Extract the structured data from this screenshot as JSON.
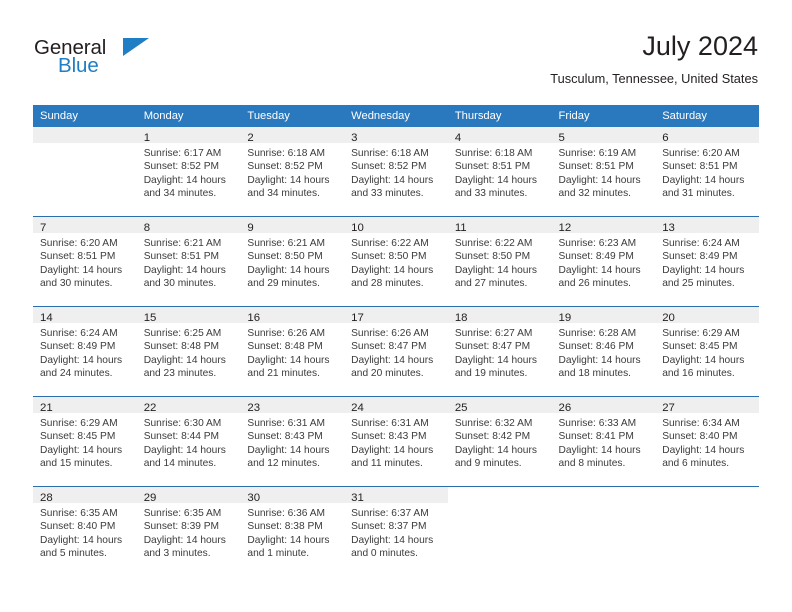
{
  "brand": {
    "word_one": "General",
    "word_two": "Blue",
    "accent_color": "#1f7ec4",
    "triangle_icon": "triangle-icon"
  },
  "header": {
    "title": "July 2024",
    "location": "Tusculum, Tennessee, United States"
  },
  "calendar": {
    "header_bg": "#2a78bd",
    "row_divider_color": "#2a6ead",
    "daynum_band_bg": "#efefef",
    "weekday_headers": [
      "Sunday",
      "Monday",
      "Tuesday",
      "Wednesday",
      "Thursday",
      "Friday",
      "Saturday"
    ],
    "labels": {
      "sunrise": "Sunrise:",
      "sunset": "Sunset:",
      "daylight": "Daylight:"
    },
    "weeks": [
      [
        {
          "day": "",
          "sunrise": "",
          "sunset": "",
          "daylight_line1": "",
          "daylight_line2": "",
          "blank": true
        },
        {
          "day": "1",
          "sunrise": "Sunrise: 6:17 AM",
          "sunset": "Sunset: 8:52 PM",
          "daylight_line1": "Daylight: 14 hours",
          "daylight_line2": "and 34 minutes."
        },
        {
          "day": "2",
          "sunrise": "Sunrise: 6:18 AM",
          "sunset": "Sunset: 8:52 PM",
          "daylight_line1": "Daylight: 14 hours",
          "daylight_line2": "and 34 minutes."
        },
        {
          "day": "3",
          "sunrise": "Sunrise: 6:18 AM",
          "sunset": "Sunset: 8:52 PM",
          "daylight_line1": "Daylight: 14 hours",
          "daylight_line2": "and 33 minutes."
        },
        {
          "day": "4",
          "sunrise": "Sunrise: 6:18 AM",
          "sunset": "Sunset: 8:51 PM",
          "daylight_line1": "Daylight: 14 hours",
          "daylight_line2": "and 33 minutes."
        },
        {
          "day": "5",
          "sunrise": "Sunrise: 6:19 AM",
          "sunset": "Sunset: 8:51 PM",
          "daylight_line1": "Daylight: 14 hours",
          "daylight_line2": "and 32 minutes."
        },
        {
          "day": "6",
          "sunrise": "Sunrise: 6:20 AM",
          "sunset": "Sunset: 8:51 PM",
          "daylight_line1": "Daylight: 14 hours",
          "daylight_line2": "and 31 minutes."
        }
      ],
      [
        {
          "day": "7",
          "sunrise": "Sunrise: 6:20 AM",
          "sunset": "Sunset: 8:51 PM",
          "daylight_line1": "Daylight: 14 hours",
          "daylight_line2": "and 30 minutes."
        },
        {
          "day": "8",
          "sunrise": "Sunrise: 6:21 AM",
          "sunset": "Sunset: 8:51 PM",
          "daylight_line1": "Daylight: 14 hours",
          "daylight_line2": "and 30 minutes."
        },
        {
          "day": "9",
          "sunrise": "Sunrise: 6:21 AM",
          "sunset": "Sunset: 8:50 PM",
          "daylight_line1": "Daylight: 14 hours",
          "daylight_line2": "and 29 minutes."
        },
        {
          "day": "10",
          "sunrise": "Sunrise: 6:22 AM",
          "sunset": "Sunset: 8:50 PM",
          "daylight_line1": "Daylight: 14 hours",
          "daylight_line2": "and 28 minutes."
        },
        {
          "day": "11",
          "sunrise": "Sunrise: 6:22 AM",
          "sunset": "Sunset: 8:50 PM",
          "daylight_line1": "Daylight: 14 hours",
          "daylight_line2": "and 27 minutes."
        },
        {
          "day": "12",
          "sunrise": "Sunrise: 6:23 AM",
          "sunset": "Sunset: 8:49 PM",
          "daylight_line1": "Daylight: 14 hours",
          "daylight_line2": "and 26 minutes."
        },
        {
          "day": "13",
          "sunrise": "Sunrise: 6:24 AM",
          "sunset": "Sunset: 8:49 PM",
          "daylight_line1": "Daylight: 14 hours",
          "daylight_line2": "and 25 minutes."
        }
      ],
      [
        {
          "day": "14",
          "sunrise": "Sunrise: 6:24 AM",
          "sunset": "Sunset: 8:49 PM",
          "daylight_line1": "Daylight: 14 hours",
          "daylight_line2": "and 24 minutes."
        },
        {
          "day": "15",
          "sunrise": "Sunrise: 6:25 AM",
          "sunset": "Sunset: 8:48 PM",
          "daylight_line1": "Daylight: 14 hours",
          "daylight_line2": "and 23 minutes."
        },
        {
          "day": "16",
          "sunrise": "Sunrise: 6:26 AM",
          "sunset": "Sunset: 8:48 PM",
          "daylight_line1": "Daylight: 14 hours",
          "daylight_line2": "and 21 minutes."
        },
        {
          "day": "17",
          "sunrise": "Sunrise: 6:26 AM",
          "sunset": "Sunset: 8:47 PM",
          "daylight_line1": "Daylight: 14 hours",
          "daylight_line2": "and 20 minutes."
        },
        {
          "day": "18",
          "sunrise": "Sunrise: 6:27 AM",
          "sunset": "Sunset: 8:47 PM",
          "daylight_line1": "Daylight: 14 hours",
          "daylight_line2": "and 19 minutes."
        },
        {
          "day": "19",
          "sunrise": "Sunrise: 6:28 AM",
          "sunset": "Sunset: 8:46 PM",
          "daylight_line1": "Daylight: 14 hours",
          "daylight_line2": "and 18 minutes."
        },
        {
          "day": "20",
          "sunrise": "Sunrise: 6:29 AM",
          "sunset": "Sunset: 8:45 PM",
          "daylight_line1": "Daylight: 14 hours",
          "daylight_line2": "and 16 minutes."
        }
      ],
      [
        {
          "day": "21",
          "sunrise": "Sunrise: 6:29 AM",
          "sunset": "Sunset: 8:45 PM",
          "daylight_line1": "Daylight: 14 hours",
          "daylight_line2": "and 15 minutes."
        },
        {
          "day": "22",
          "sunrise": "Sunrise: 6:30 AM",
          "sunset": "Sunset: 8:44 PM",
          "daylight_line1": "Daylight: 14 hours",
          "daylight_line2": "and 14 minutes."
        },
        {
          "day": "23",
          "sunrise": "Sunrise: 6:31 AM",
          "sunset": "Sunset: 8:43 PM",
          "daylight_line1": "Daylight: 14 hours",
          "daylight_line2": "and 12 minutes."
        },
        {
          "day": "24",
          "sunrise": "Sunrise: 6:31 AM",
          "sunset": "Sunset: 8:43 PM",
          "daylight_line1": "Daylight: 14 hours",
          "daylight_line2": "and 11 minutes."
        },
        {
          "day": "25",
          "sunrise": "Sunrise: 6:32 AM",
          "sunset": "Sunset: 8:42 PM",
          "daylight_line1": "Daylight: 14 hours",
          "daylight_line2": "and 9 minutes."
        },
        {
          "day": "26",
          "sunrise": "Sunrise: 6:33 AM",
          "sunset": "Sunset: 8:41 PM",
          "daylight_line1": "Daylight: 14 hours",
          "daylight_line2": "and 8 minutes."
        },
        {
          "day": "27",
          "sunrise": "Sunrise: 6:34 AM",
          "sunset": "Sunset: 8:40 PM",
          "daylight_line1": "Daylight: 14 hours",
          "daylight_line2": "and 6 minutes."
        }
      ],
      [
        {
          "day": "28",
          "sunrise": "Sunrise: 6:35 AM",
          "sunset": "Sunset: 8:40 PM",
          "daylight_line1": "Daylight: 14 hours",
          "daylight_line2": "and 5 minutes."
        },
        {
          "day": "29",
          "sunrise": "Sunrise: 6:35 AM",
          "sunset": "Sunset: 8:39 PM",
          "daylight_line1": "Daylight: 14 hours",
          "daylight_line2": "and 3 minutes."
        },
        {
          "day": "30",
          "sunrise": "Sunrise: 6:36 AM",
          "sunset": "Sunset: 8:38 PM",
          "daylight_line1": "Daylight: 14 hours",
          "daylight_line2": "and 1 minute."
        },
        {
          "day": "31",
          "sunrise": "Sunrise: 6:37 AM",
          "sunset": "Sunset: 8:37 PM",
          "daylight_line1": "Daylight: 14 hours",
          "daylight_line2": "and 0 minutes."
        },
        {
          "day": "",
          "sunrise": "",
          "sunset": "",
          "daylight_line1": "",
          "daylight_line2": "",
          "blank": true
        },
        {
          "day": "",
          "sunrise": "",
          "sunset": "",
          "daylight_line1": "",
          "daylight_line2": "",
          "blank": true
        },
        {
          "day": "",
          "sunrise": "",
          "sunset": "",
          "daylight_line1": "",
          "daylight_line2": "",
          "blank": true
        }
      ]
    ]
  }
}
